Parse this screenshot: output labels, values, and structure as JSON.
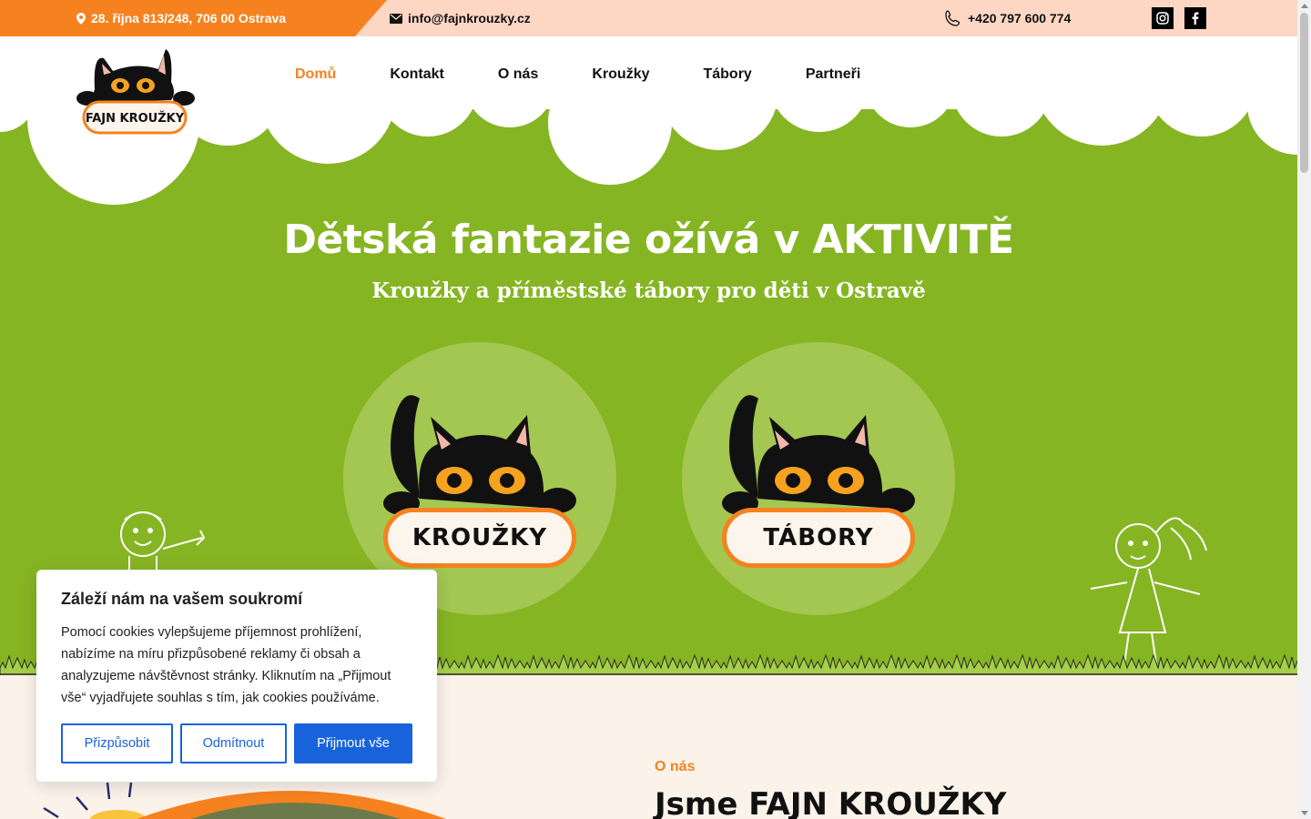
{
  "topbar": {
    "address": "28. října 813/248, 706 00 Ostrava",
    "email": "info@fajnkrouzky.cz",
    "phone": "+420 797 600 774",
    "social": [
      {
        "icon": "instagram-icon"
      },
      {
        "icon": "facebook-icon"
      }
    ]
  },
  "logo": {
    "text": "FAJN KROUŽKY"
  },
  "nav": {
    "items": [
      {
        "label": "Domů",
        "active": true
      },
      {
        "label": "Kontakt"
      },
      {
        "label": "O nás"
      },
      {
        "label": "Kroužky"
      },
      {
        "label": "Tábory"
      },
      {
        "label": "Partneři"
      }
    ]
  },
  "hero": {
    "title": "Dětská fantazie ožívá v AKTIVITĚ",
    "subtitle": "Kroužky a příměstské tábory pro děti v Ostravě",
    "cards": [
      {
        "label": "KROUŽKY"
      },
      {
        "label": "TÁBORY"
      }
    ]
  },
  "about": {
    "label": "O nás",
    "title": "Jsme FAJN KROUŽKY"
  },
  "cookie": {
    "title": "Záleží nám na vašem soukromí",
    "text": "Pomocí cookies vylepšujeme příjemnost prohlížení, nabízíme na míru přizpůsobené reklamy či obsah a analyzujeme návštěvnost stránky. Kliknutím na „Přijmout vše“ vyjadřujete souhlas s tím, jak cookies používáme.",
    "customize": "Přizpůsobit",
    "reject": "Odmítnout",
    "accept": "Přijmout vše"
  },
  "colors": {
    "orange": "#f6821f",
    "green": "#86b523",
    "blue": "#1863dc",
    "peach": "#fdd7c4"
  }
}
